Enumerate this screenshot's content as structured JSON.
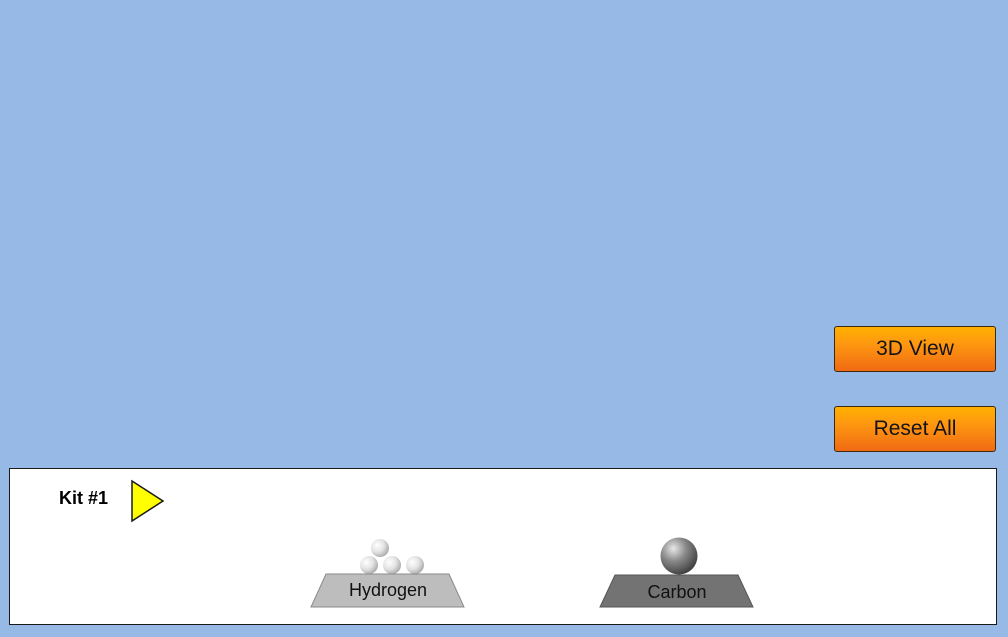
{
  "controls": {
    "view3d_label": "3D View",
    "reset_label": "Reset All"
  },
  "kit": {
    "title": "Kit #1",
    "buckets": [
      {
        "label": "Hydrogen",
        "atom_color": "#e6e6e6",
        "tray_color": "#bcbcbc",
        "atom_count": 4
      },
      {
        "label": "Carbon",
        "atom_color": "#707070",
        "tray_color": "#727272",
        "atom_count": 1
      }
    ]
  },
  "colors": {
    "background": "#96bae5",
    "button_accent": "#f57f14",
    "next_arrow": "#ffff00"
  },
  "icons": {
    "next_kit": "play-triangle-icon"
  }
}
